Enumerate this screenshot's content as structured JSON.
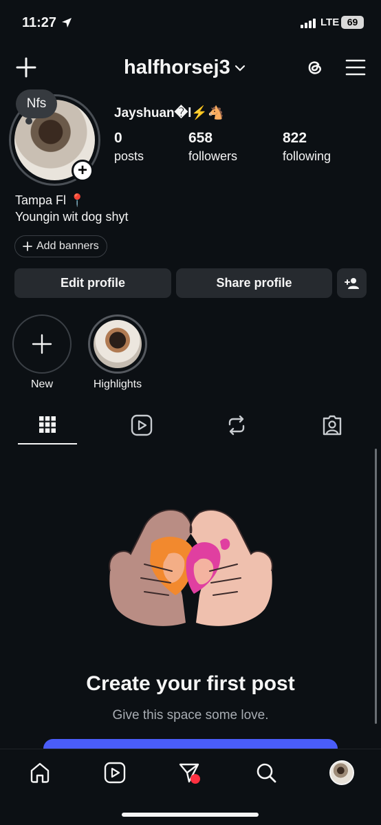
{
  "status_bar": {
    "time": "11:27",
    "network": "LTE",
    "battery": "69"
  },
  "header": {
    "username": "halfhorsej3",
    "icons": [
      "plus-icon",
      "chevron-down-icon",
      "threads-icon",
      "menu-icon"
    ]
  },
  "profile": {
    "note": "Nfs",
    "display_name": "Jayshuan�l⚡🐴",
    "stats": [
      {
        "value": "0",
        "label": "posts"
      },
      {
        "value": "658",
        "label": "followers"
      },
      {
        "value": "822",
        "label": "following"
      }
    ],
    "bio_line1": "Tampa Fl 📍",
    "bio_line2": "Youngin wit dog shyt",
    "add_banners": "Add banners"
  },
  "buttons": {
    "edit": "Edit profile",
    "share": "Share profile"
  },
  "highlights": [
    {
      "label": "New"
    },
    {
      "label": "Highlights"
    }
  ],
  "tabs": [
    "grid-icon",
    "reels-icon",
    "reposts-icon",
    "tagged-icon"
  ],
  "empty_state": {
    "title": "Create your first post",
    "subtitle": "Give this space some love."
  },
  "bottom_nav": [
    "home-icon",
    "reels-icon",
    "messages-icon",
    "search-icon",
    "profile-avatar"
  ],
  "colors": {
    "background": "#0c1014",
    "button": "#262a2f",
    "accent": "#4a5df9",
    "notification": "#ff3040"
  }
}
